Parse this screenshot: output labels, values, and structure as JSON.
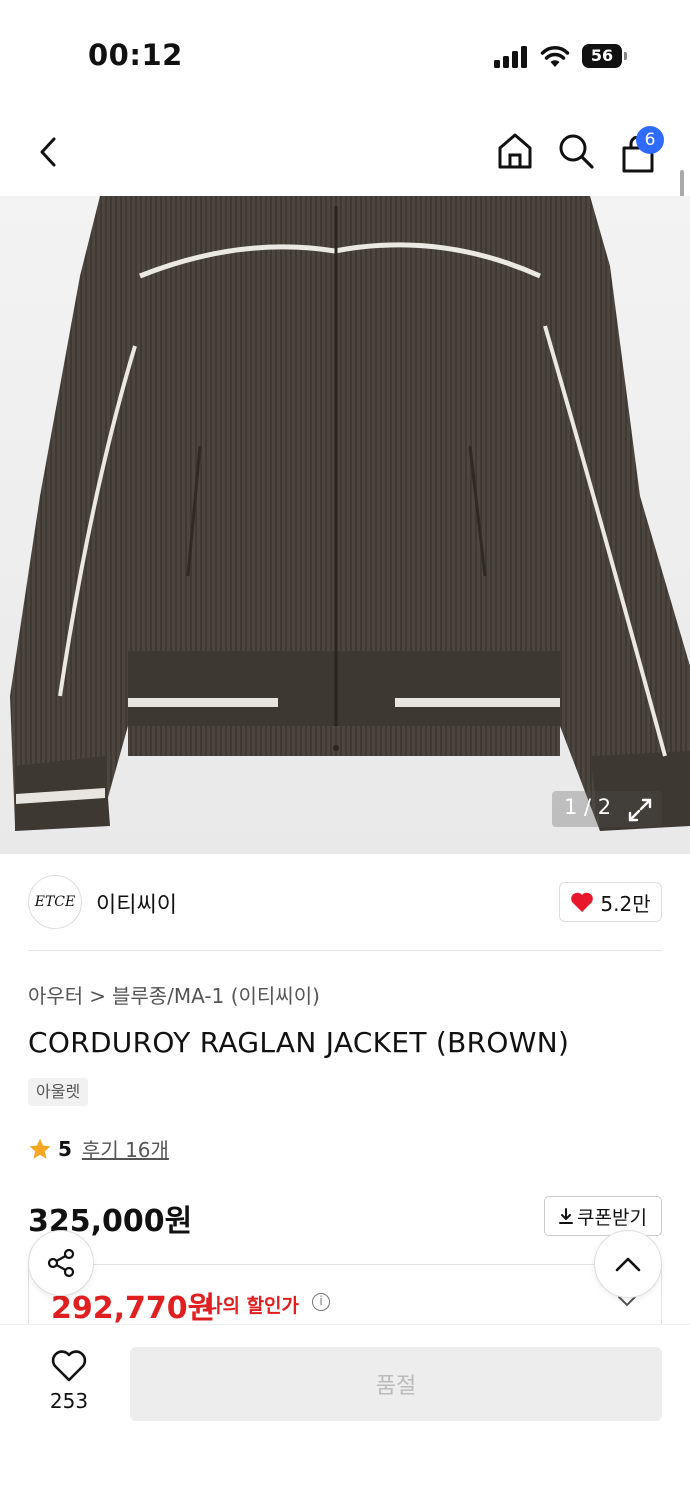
{
  "status_bar": {
    "time": "00:12",
    "battery": "56"
  },
  "header": {
    "cart_count": "6"
  },
  "gallery": {
    "counter": "1 / 2"
  },
  "brand": {
    "logo_text": "ETCE",
    "name": "이티씨이",
    "likes": "5.2만"
  },
  "breadcrumb": {
    "category": "아우터",
    "separator": ">",
    "subcategory": "블루종/MA-1 (이티씨이)"
  },
  "product": {
    "title": "CORDUROY RAGLAN JACKET (BROWN)",
    "tag": "아울렛",
    "rating": "5",
    "reviews": "후기 16개",
    "price": "325,000원",
    "coupon_label": "쿠폰받기",
    "discount_price": "292,770원",
    "discount_label": "나의 할인가",
    "info_symbol": "i"
  },
  "bottom_bar": {
    "wish_count": "253",
    "soldout_label": "품절"
  },
  "colors": {
    "accent_red": "#e02020",
    "badge_blue": "#2f6bff",
    "heart_red": "#e8182c",
    "star": "#f5a623"
  },
  "icons": [
    "back-arrow-icon",
    "home-icon",
    "search-icon",
    "cart-icon",
    "expand-icon",
    "heart-icon",
    "star-icon",
    "download-icon",
    "share-icon",
    "chevron-up-icon",
    "chevron-down-icon",
    "info-icon"
  ]
}
